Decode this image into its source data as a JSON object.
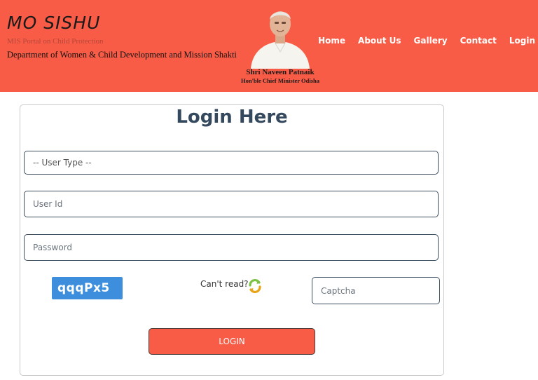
{
  "header": {
    "brand_title": "MO SISHU",
    "brand_tagline": "MIS Portal on Child Protection",
    "department": "Department of Women & Child Development and Mission Shakti",
    "cm_name": "Shri Naveen Patnaik",
    "cm_title": "Hon'ble Chief Minister Odisha",
    "background_color": "#f95c46"
  },
  "nav": {
    "items": [
      {
        "label": "Home"
      },
      {
        "label": "About Us"
      },
      {
        "label": "Gallery"
      },
      {
        "label": "Contact"
      },
      {
        "label": "Login"
      }
    ]
  },
  "login": {
    "heading": "Login Here",
    "user_type_selected": "-- User Type --",
    "user_id_placeholder": "User Id",
    "password_placeholder": "Password",
    "captcha_code": "qqqPx5",
    "cant_read": "Can't read?",
    "captcha_placeholder": "Captcha",
    "submit_label": "LOGIN",
    "heading_color": "#34495e",
    "captcha_color": "#3d8fde"
  }
}
